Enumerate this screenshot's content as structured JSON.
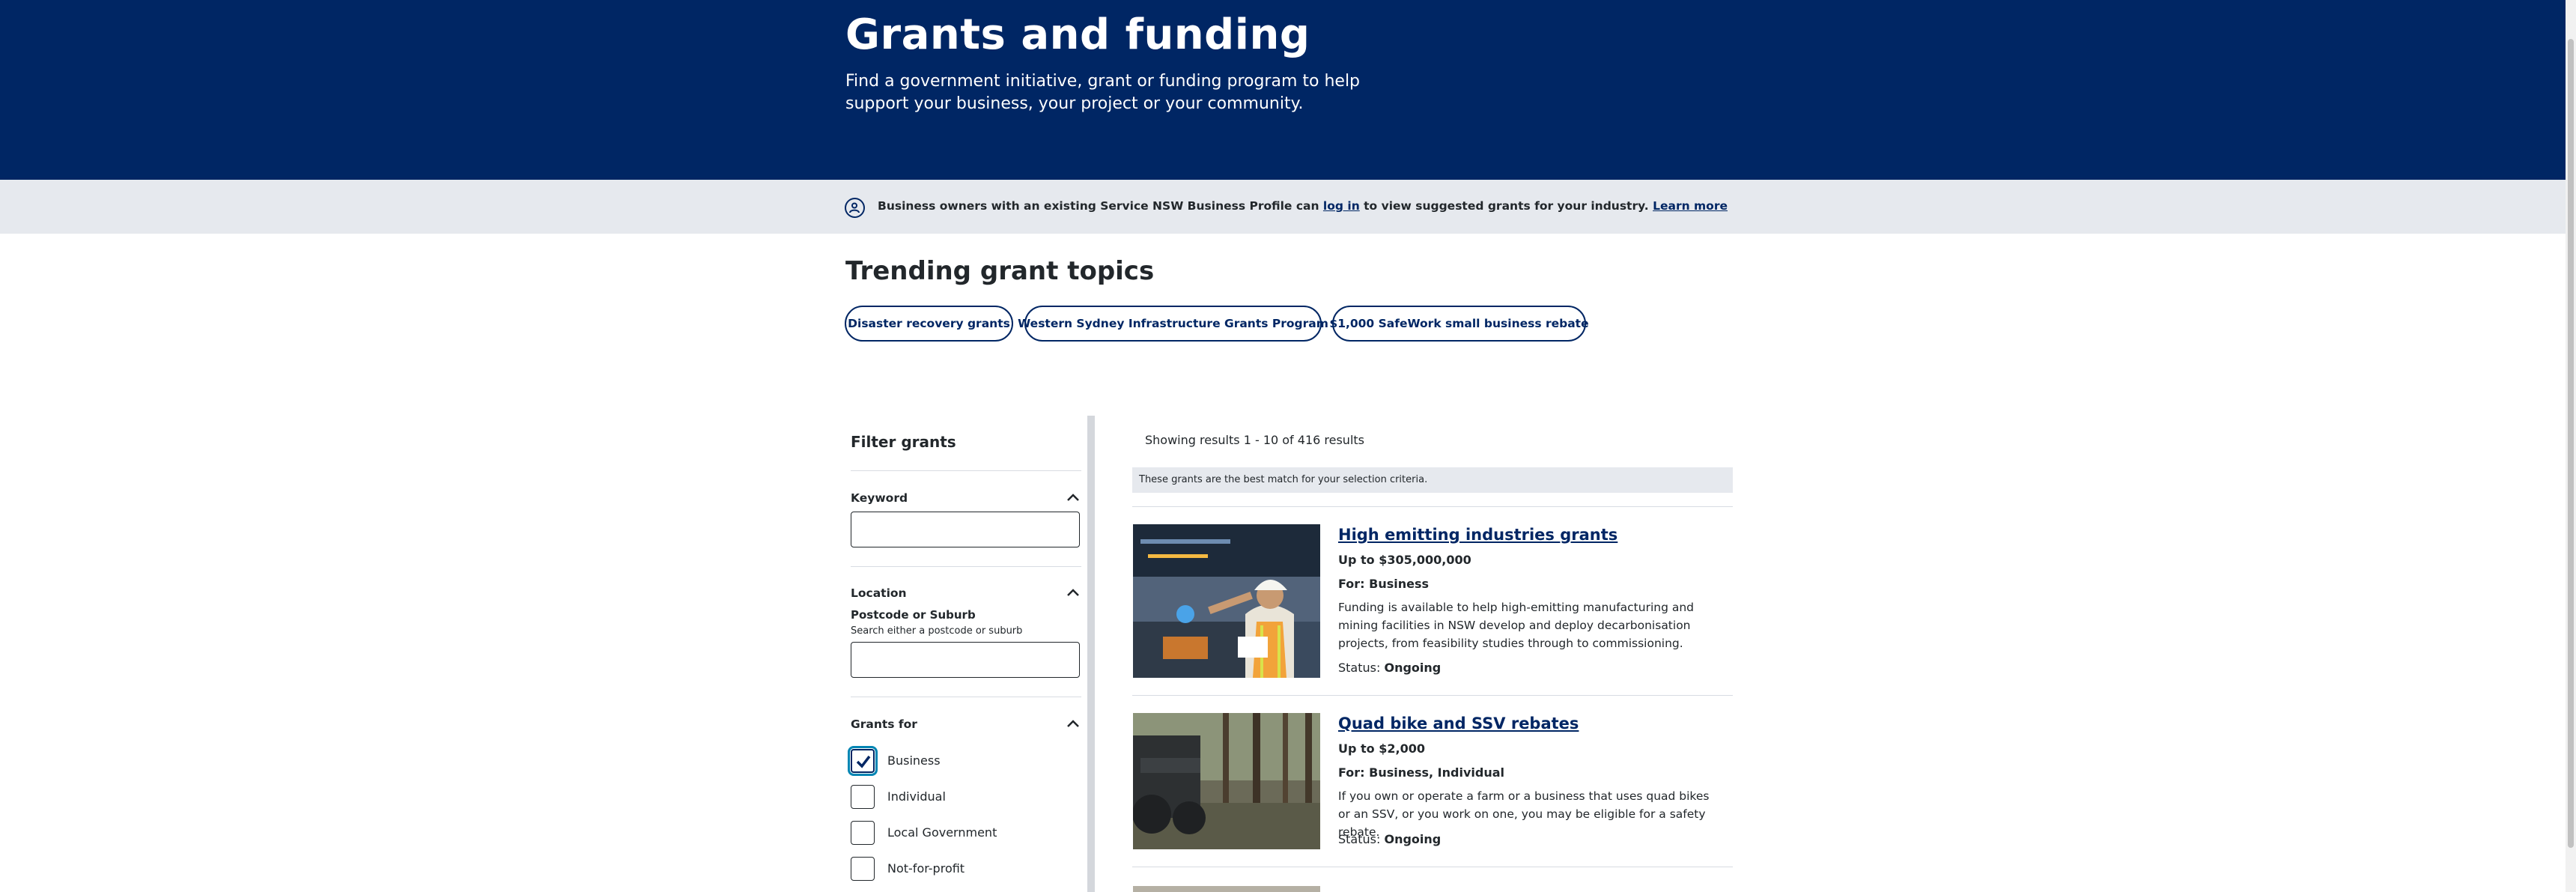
{
  "hero": {
    "title": "Grants and funding",
    "subtitle": "Find a government initiative, grant or funding program to help support your business, your project or your community."
  },
  "banner": {
    "text_before": "Business owners with an existing Service NSW Business Profile can ",
    "login_link": "log in",
    "text_after": " to view suggested grants for your industry. ",
    "learn_more": "Learn more"
  },
  "trending": {
    "title": "Trending grant topics",
    "pills": [
      "Disaster recovery grants",
      "Western Sydney Infrastructure Grants Program",
      "$1,000 SafeWork small business rebate"
    ]
  },
  "filter": {
    "title": "Filter grants",
    "keyword_label": "Keyword",
    "location_label": "Location",
    "postcode_label": "Postcode or Suburb",
    "postcode_helper": "Search either a postcode or suburb",
    "grants_for_label": "Grants for",
    "options": [
      {
        "label": "Business",
        "checked": true
      },
      {
        "label": "Individual",
        "checked": false
      },
      {
        "label": "Local Government",
        "checked": false
      },
      {
        "label": "Not-for-profit",
        "checked": false
      }
    ]
  },
  "results": {
    "count_text": "Showing results 1 - 10 of 416 results",
    "match_text": "These grants are the best match for your selection criteria.",
    "items": [
      {
        "title": "High emitting industries grants",
        "amount": "Up to $305,000,000",
        "for": "For: Business",
        "description": "Funding is available to help high-emitting manufacturing and mining facilities in NSW develop and deploy decarbonisation projects, from feasibility studies through to commissioning.",
        "status_label": "Status:",
        "status_value": "Ongoing"
      },
      {
        "title": "Quad bike and SSV rebates",
        "amount": "Up to $2,000",
        "for": "For: Business, Individual",
        "description": "If you own or operate a farm or a business that uses quad bikes or an SSV, or you work on one, you may be eligible for a safety rebate.",
        "status_label": "Status:",
        "status_value": "Ongoing"
      }
    ]
  },
  "colors": {
    "brand_navy": "#002664",
    "banner_grey": "#e6e9ee",
    "focus_blue": "#0085b3"
  }
}
